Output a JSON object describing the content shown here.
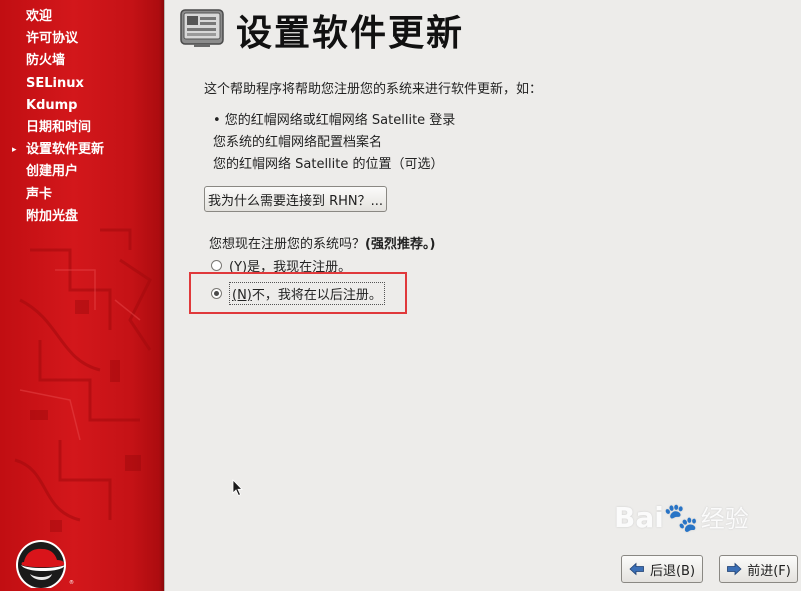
{
  "sidebar": {
    "items": [
      {
        "label": "欢迎",
        "current": false
      },
      {
        "label": "许可协议",
        "current": false
      },
      {
        "label": "防火墙",
        "current": false
      },
      {
        "label": "SELinux",
        "current": false
      },
      {
        "label": "Kdump",
        "current": false
      },
      {
        "label": "日期和时间",
        "current": false
      },
      {
        "label": "设置软件更新",
        "current": true
      },
      {
        "label": "创建用户",
        "current": false
      },
      {
        "label": "声卡",
        "current": false
      },
      {
        "label": "附加光盘",
        "current": false
      }
    ],
    "current_marker": "▸"
  },
  "header": {
    "title": "设置软件更新",
    "icon": "software-update-icon"
  },
  "content": {
    "intro": "这个帮助程序将帮助您注册您的系统来进行软件更新，如：",
    "bullets": [
      "• 您的红帽网络或红帽网络 Satellite 登录",
      "您系统的红帽网络配置档案名",
      "您的红帽网络 Satellite 的位置（可选）"
    ],
    "rhn_button": "我为什么需要连接到 RHN？...",
    "question_prefix": "您想现在注册您的系统吗？",
    "question_emphasis": "(强烈推荐。)",
    "radio_yes": {
      "mnemonic": "(Y)",
      "text": "是，我现在注册。",
      "selected": false
    },
    "radio_no": {
      "mnemonic": "(N)",
      "text": "不，我将在以后注册。",
      "selected": true
    }
  },
  "footer": {
    "back_label": "后退(B)",
    "next_label": "前进(F)"
  },
  "watermark": {
    "latin": "Bai",
    "paw": "🐾",
    "cn": "经验"
  },
  "colors": {
    "sidebar_red": "#cc0000",
    "highlight_red": "#e0393b",
    "background": "#edecea"
  }
}
